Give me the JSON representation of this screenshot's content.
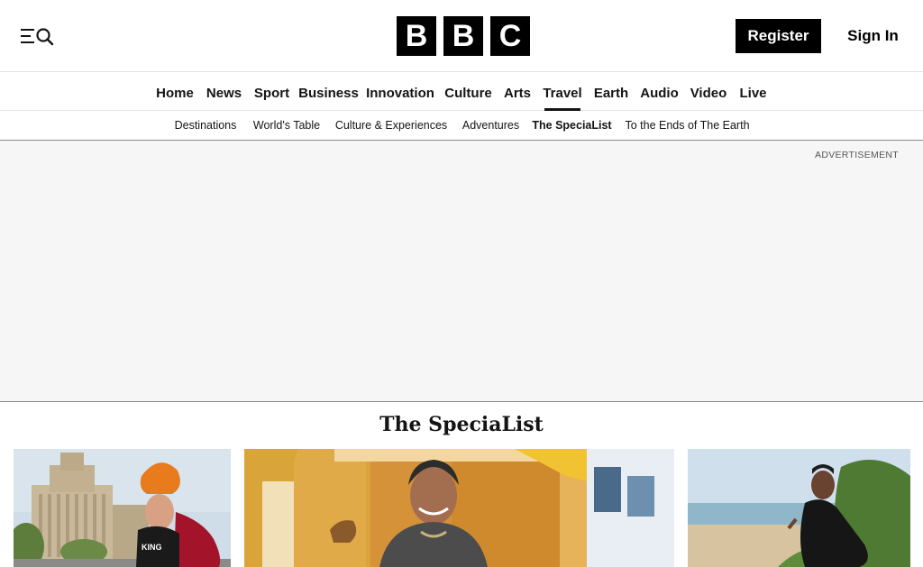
{
  "header": {
    "logo_letters": [
      "B",
      "B",
      "C"
    ],
    "register_label": "Register",
    "signin_label": "Sign In",
    "menu_icon": "menu-search-icon"
  },
  "nav": {
    "items": [
      {
        "label": "Home"
      },
      {
        "label": "News"
      },
      {
        "label": "Sport"
      },
      {
        "label": "Business"
      },
      {
        "label": "Innovation"
      },
      {
        "label": "Culture"
      },
      {
        "label": "Arts"
      },
      {
        "label": "Travel",
        "active": true
      },
      {
        "label": "Earth"
      },
      {
        "label": "Audio"
      },
      {
        "label": "Video"
      },
      {
        "label": "Live"
      }
    ]
  },
  "subnav": {
    "items": [
      {
        "label": "Destinations"
      },
      {
        "label": "World's Table"
      },
      {
        "label": "Culture & Experiences"
      },
      {
        "label": "Adventures"
      },
      {
        "label": "The SpeciaList",
        "active": true
      },
      {
        "label": "To the Ends of The Earth"
      }
    ]
  },
  "ad": {
    "label": "ADVERTISEMENT"
  },
  "section": {
    "title": "The SpeciaList"
  },
  "colors": {
    "brand": "#000000",
    "ad_background": "#f6f6f6",
    "divider": "#e3e3e3"
  }
}
